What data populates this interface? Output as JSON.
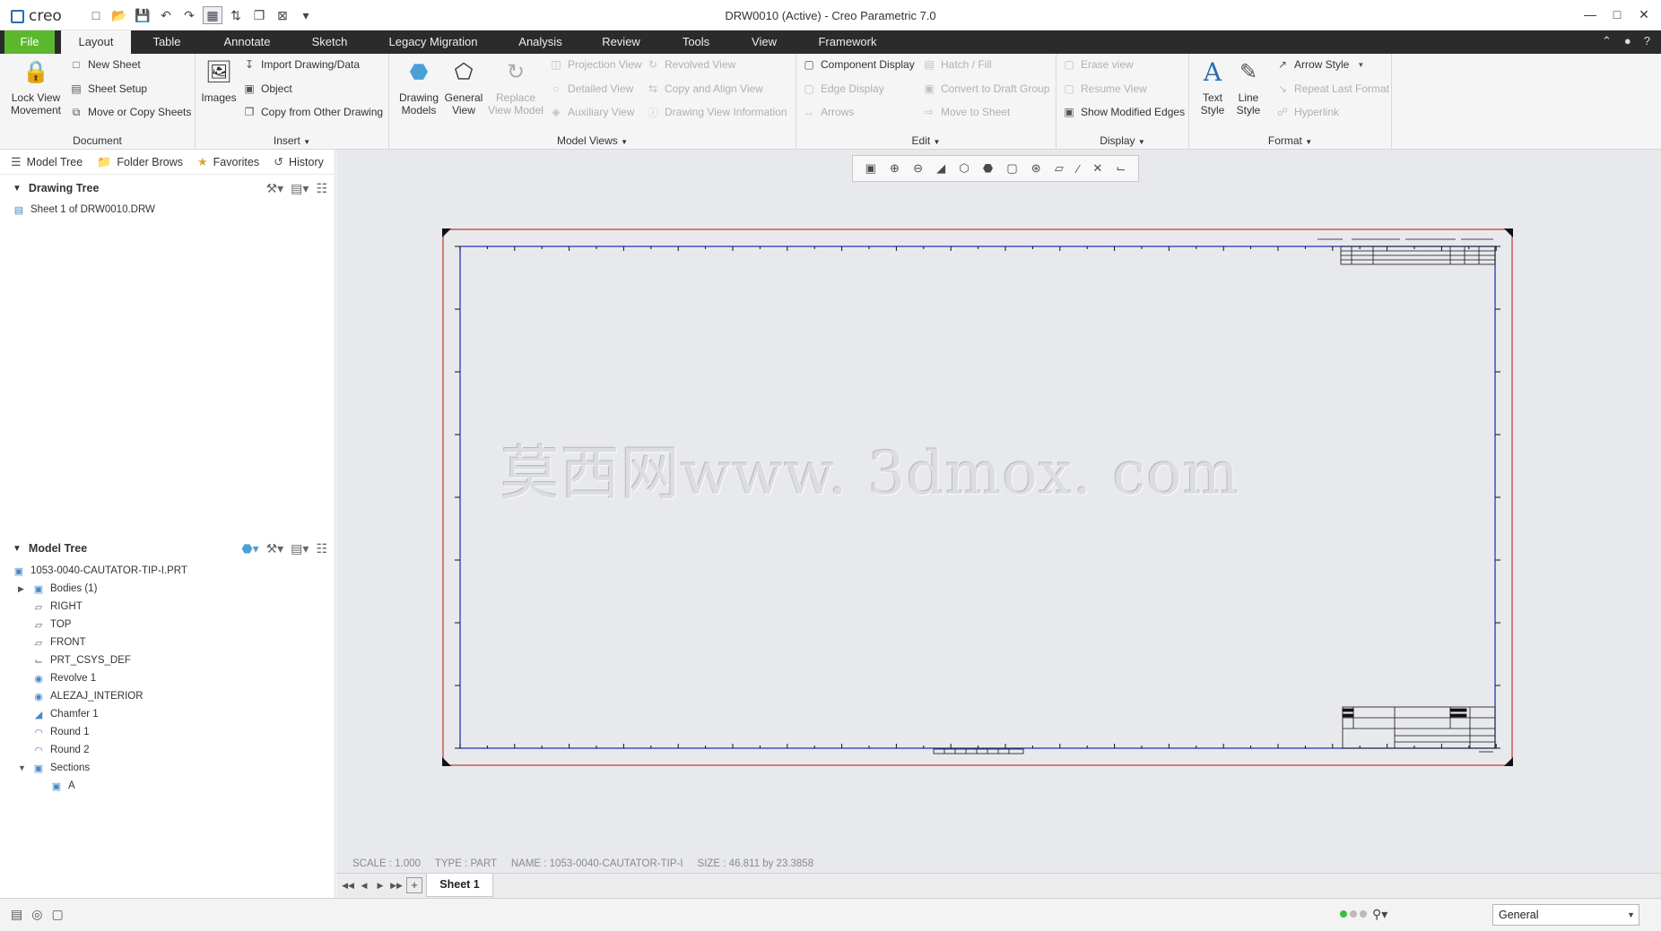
{
  "titlebar": {
    "logo": "creo",
    "window_title": "DRW0010 (Active) - Creo Parametric 7.0",
    "quick_access": [
      "new-icon",
      "open-icon",
      "save-icon",
      "undo-icon",
      "redo-icon",
      "select-box-icon",
      "regenerate-icon",
      "windows-icon",
      "close-window-icon",
      "customize-icon"
    ]
  },
  "tabs": [
    "File",
    "Layout",
    "Table",
    "Annotate",
    "Sketch",
    "Legacy Migration",
    "Analysis",
    "Review",
    "Tools",
    "View",
    "Framework"
  ],
  "active_tab": "Layout",
  "ribbon": {
    "document": {
      "label": "Document",
      "lock_view": "Lock View\nMovement",
      "new_sheet": "New Sheet",
      "sheet_setup": "Sheet Setup",
      "move_copy": "Move or Copy Sheets"
    },
    "insert": {
      "label": "Insert",
      "images": "Images",
      "import": "Import Drawing/Data",
      "object": "Object",
      "copy_from": "Copy from Other Drawing"
    },
    "model_views": {
      "label": "Model Views",
      "drawing_models": "Drawing\nModels",
      "general_view": "General\nView",
      "replace_model": "Replace\nView Model",
      "projection": "Projection View",
      "detailed": "Detailed View",
      "auxiliary": "Auxiliary View",
      "revolved": "Revolved View",
      "copy_align": "Copy and Align View",
      "info": "Drawing View Information"
    },
    "edit": {
      "label": "Edit",
      "component_display": "Component Display",
      "edge_display": "Edge Display",
      "arrows": "Arrows",
      "hatch": "Hatch / Fill",
      "convert": "Convert to Draft Group",
      "move_to_sheet": "Move to Sheet"
    },
    "display": {
      "label": "Display",
      "erase": "Erase view",
      "resume": "Resume View",
      "show_modified": "Show Modified Edges"
    },
    "format": {
      "label": "Format",
      "text_style": "Text\nStyle",
      "line_style": "Line\nStyle",
      "arrow_style": "Arrow Style",
      "repeat": "Repeat Last Format",
      "hyperlink": "Hyperlink"
    }
  },
  "navigator": {
    "tabs": [
      "Model Tree",
      "Folder Brows",
      "Favorites",
      "History"
    ],
    "drawing_tree": {
      "title": "Drawing Tree",
      "items": [
        "Sheet 1 of DRW0010.DRW"
      ]
    },
    "model_tree": {
      "title": "Model Tree",
      "items": [
        "1053-0040-CAUTATOR-TIP-I.PRT",
        "Bodies (1)",
        "RIGHT",
        "TOP",
        "FRONT",
        "PRT_CSYS_DEF",
        "Revolve 1",
        "ALEZAJ_INTERIOR",
        "Chamfer 1",
        "Round 1",
        "Round 2",
        "Sections",
        "A"
      ]
    }
  },
  "canvas": {
    "watermark": "莫西网www. 3dmox. com",
    "status_info": "SCALE : 1.000     TYPE : PART     NAME : 1053-0040-CAUTATOR-TIP-I     SIZE : 46.811 by 23.3858"
  },
  "sheetbar": {
    "sheet_tab": "Sheet 1"
  },
  "statusbar": {
    "filter": "General"
  },
  "colors": {
    "file_tab": "#5bb82c",
    "tab_bar": "#2b2b2b",
    "sheet_border": "#c0392b",
    "sheet_frame": "#1c2aa8"
  }
}
